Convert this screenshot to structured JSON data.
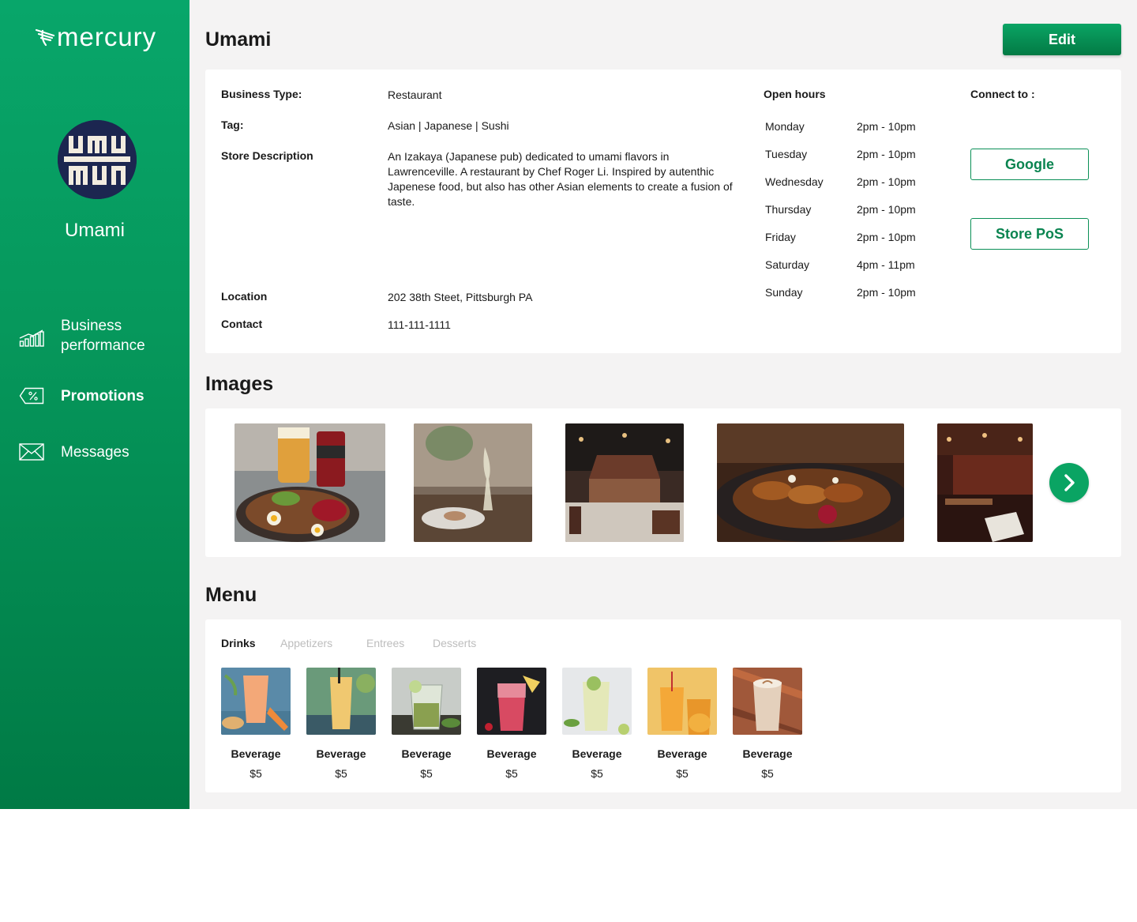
{
  "brand": {
    "logo_text": "mercury",
    "accent": "#06985c"
  },
  "sidebar": {
    "store_name": "Umami",
    "nav": [
      {
        "label": "Business performance",
        "icon": "bar-chart-icon"
      },
      {
        "label": "Promotions",
        "icon": "discount-tag-icon"
      },
      {
        "label": "Messages",
        "icon": "envelope-icon"
      }
    ]
  },
  "header": {
    "title": "Umami",
    "edit_label": "Edit"
  },
  "info": {
    "business_type_label": "Business Type:",
    "business_type": "Restaurant",
    "tag_label": "Tag:",
    "tag": "Asian | Japanese | Sushi",
    "description_label": "Store Description",
    "description": "An Izakaya (Japanese pub) dedicated to umami flavors in Lawrenceville.  A restaurant by Chef Roger Li. Inspired by autenthic Japenese food, but also has other Asian elements to create a fusion of taste.",
    "location_label": "Location",
    "location": "202 38th Steet, Pittsburgh PA",
    "contact_label": "Contact",
    "contact": "111-111-1111"
  },
  "hours": {
    "title": "Open hours",
    "rows": [
      {
        "day": "Monday",
        "time": "2pm - 10pm"
      },
      {
        "day": "Tuesday",
        "time": "2pm - 10pm"
      },
      {
        "day": "Wednesday",
        "time": "2pm - 10pm"
      },
      {
        "day": "Thursday",
        "time": "2pm - 10pm"
      },
      {
        "day": "Friday",
        "time": "2pm - 10pm"
      },
      {
        "day": "Saturday",
        "time": "4pm - 11pm"
      },
      {
        "day": "Sunday",
        "time": "2pm - 10pm"
      }
    ]
  },
  "connect": {
    "title": "Connect to :",
    "google_label": "Google",
    "pos_label": "Store PoS"
  },
  "images": {
    "title": "Images"
  },
  "menu": {
    "title": "Menu",
    "tabs": [
      "Drinks",
      "Appetizers",
      "Entrees",
      "Desserts"
    ],
    "active_tab": "Drinks",
    "items": [
      {
        "name": "Beverage",
        "price": "$5"
      },
      {
        "name": "Beverage",
        "price": "$5"
      },
      {
        "name": "Beverage",
        "price": "$5"
      },
      {
        "name": "Beverage",
        "price": "$5"
      },
      {
        "name": "Beverage",
        "price": "$5"
      },
      {
        "name": "Beverage",
        "price": "$5"
      },
      {
        "name": "Beverage",
        "price": "$5"
      }
    ]
  }
}
